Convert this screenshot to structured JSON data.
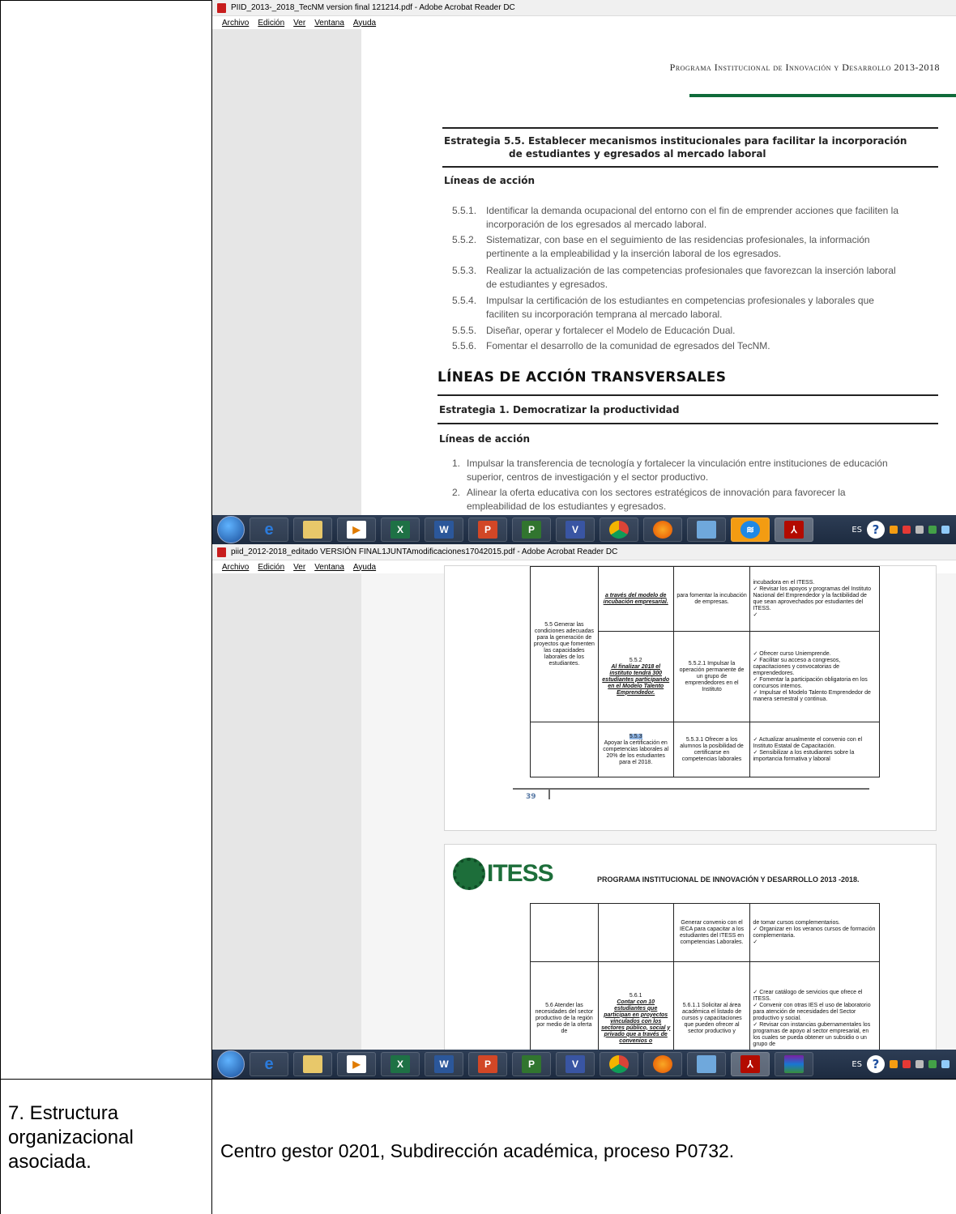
{
  "window1": {
    "title": "PIID_2013-_2018_TecNM version final 121214.pdf - Adobe Acrobat Reader DC",
    "menu": [
      "Archivo",
      "Edición",
      "Ver",
      "Ventana",
      "Ayuda"
    ],
    "running_head": "Programa Institucional de Innovación y Desarrollo 2013-2018",
    "strategy55_line1": "Estrategia 5.5. Establecer mecanismos institucionales para facilitar la incorporación",
    "strategy55_line2": "de estudiantes y egresados al mercado laboral",
    "lineas_accion": "Líneas de acción",
    "items": [
      {
        "num": "5.5.1.",
        "l1": "Identificar la demanda ocupacional del entorno con el fin de emprender acciones que faciliten la",
        "l2": "incorporación de los egresados al mercado laboral."
      },
      {
        "num": "5.5.2.",
        "l1": "Sistematizar, con base en el seguimiento de las residencias profesionales, la información",
        "l2": "pertinente a la empleabilidad y la inserción laboral de los egresados."
      },
      {
        "num": "5.5.3.",
        "l1": "Realizar la actualización de las competencias profesionales que favorezcan la inserción laboral",
        "l2": "de estudiantes y egresados."
      },
      {
        "num": "5.5.4.",
        "l1": "Impulsar la certificación de los estudiantes en competencias profesionales y laborales que",
        "l2": "faciliten su incorporación temprana al mercado laboral."
      },
      {
        "num": "5.5.5.",
        "l1": "Diseñar, operar y fortalecer el Modelo de Educación Dual.",
        "l2": ""
      },
      {
        "num": "5.5.6.",
        "l1": "Fomentar el desarrollo de la comunidad de egresados del TecNM.",
        "l2": ""
      }
    ],
    "transversales": "LÍNEAS DE ACCIÓN TRANSVERSALES",
    "strategy1": "Estrategia 1. Democratizar la productividad",
    "lineas_accion2": "Líneas de acción",
    "items2": [
      {
        "num": "1.",
        "l1": "Impulsar la transferencia de tecnología y fortalecer la vinculación entre instituciones de educación",
        "l2": "superior, centros de investigación y el sector productivo."
      },
      {
        "num": "2.",
        "l1": "Alinear la oferta educativa con los sectores estratégicos de innovación para favorecer la",
        "l2": "empleabilidad de los estudiantes y egresados."
      }
    ]
  },
  "window2": {
    "title": "piid_2012-2018_editado VERSIÓN FINAL1JUNTAmodificaciones17042015.pdf - Adobe Acrobat Reader DC",
    "menu": [
      "Archivo",
      "Edición",
      "Ver",
      "Ventana",
      "Ayuda"
    ],
    "page_number": "39",
    "logo_text": "ITESS",
    "page_header": "PROGRAMA INSTITUCIONAL DE INNOVACIÓN Y DESARROLLO 2013 -2018.",
    "t1": {
      "r1c2": "a través del modelo de incubación empresarial.",
      "r1c3": "para fomentar la incubación de empresas.",
      "r1c4": [
        "incubadora en el ITESS.",
        "✓ Revisar los apoyos y programas del Instituto Nacional del Emprendedor y la factibilidad de que sean aprovechados por estudiantes del ITESS.",
        "✓"
      ],
      "c1": "5.5 Generar las condiciones adecuadas para la generación de proyectos que fomenten las capacidades laborales de los estudiantes.",
      "r2c2_num": "5.5.2",
      "r2c2": "Al finalizar 2018 el instituto tendrá 300 estudiantes participando en el Modelo Talento Emprendedor.",
      "r2c3": "5.5.2.1 Impulsar la operación permanente de un grupo de emprendedores en el Instituto",
      "r2c4": [
        "✓ Ofrecer curso Uniemprende.",
        "✓ Facilitar su acceso a congresos, capacitaciones y convocatorias de emprendedores.",
        "✓ Fomentar la participación obligatoria en los concursos internos.",
        "✓ Impulsar el Modelo Talento Emprendedor de manera semestral y continua."
      ],
      "r3c2_num": "5.5.3",
      "r3c2": "Apoyar la certificación en competencias laborales al 20% de los estudiantes para el 2018.",
      "r3c3": "5.5.3.1 Ofrecer a los alumnos la posibilidad de certificarse en competencias laborales",
      "r3c4": [
        "✓ Actualizar anualmente el convenio con el Instituto Estatal de Capacitación.",
        "✓ Sensibilizar a los estudiantes sobre la importancia formativa y laboral"
      ]
    },
    "t2": {
      "r1c3": "Generar convenio con el IECA para capacitar a los estudiantes del ITESS en competencias Laborales.",
      "r1c4": [
        "de tomar cursos complementarios.",
        "✓ Organizar en los veranos cursos de formación complementaria.",
        "✓"
      ],
      "c1": "5.6 Atender las necesidades del sector productivo de la región por medio de la oferta de",
      "r2c2_num": "5.6.1",
      "r2c2": "Contar con 10 estudiantes que participan en proyectos vinculados con los sectores público, social y privado que a través de convenios o",
      "r2c3": "5.6.1.1 Solicitar al área académica el listado de cursos y capacitaciones que pueden ofrecer al sector productivo y",
      "r2c4": [
        "✓ Crear catálogo de servicios que ofrece el ITESS.",
        "✓ Convenir con otras IES el uso de laboratorio para atención de necesidades del Sector productivo y social.",
        "✓ Revisar con instancias gubernamentales los programas de apoyo al sector empresarial, en los cuales se pueda obtener un subsidio o un grupo de"
      ]
    }
  },
  "taskbar": {
    "buttons1": [
      "IE",
      "DIR",
      "MP",
      "X",
      "W",
      "P",
      "P",
      "V",
      "CH",
      "FF",
      "NET",
      "WIFI",
      "PDF"
    ],
    "buttons2": [
      "IE",
      "DIR",
      "MP",
      "X",
      "W",
      "P",
      "P",
      "V",
      "CH",
      "FF",
      "NET",
      "PDF",
      "RAR"
    ],
    "lang": "ES",
    "help": "?"
  },
  "row7": {
    "label_l1": "7. Estructura",
    "label_l2": "organizacional",
    "label_l3": "asociada.",
    "value": "Centro gestor 0201, Subdirección académica, proceso P0732."
  }
}
